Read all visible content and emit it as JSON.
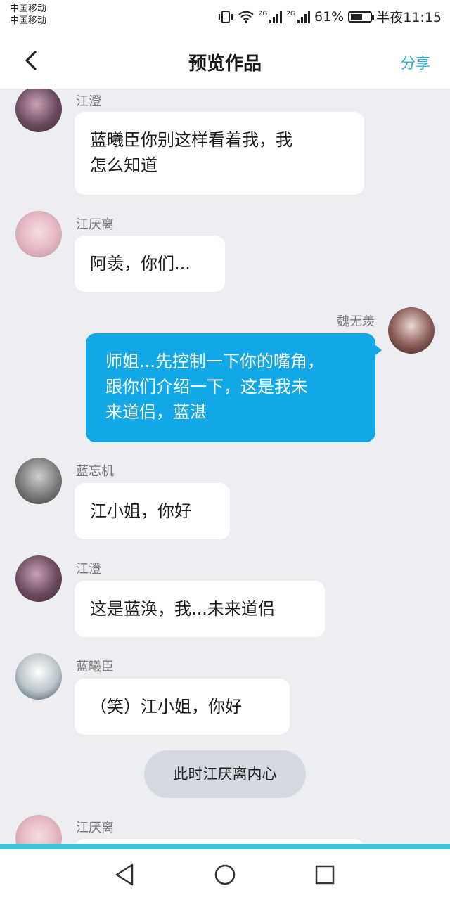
{
  "status_bar": {
    "carrier1": "中国移动",
    "carrier2": "中国移动",
    "net1": "2G",
    "net2": "2G",
    "battery_pct": "61%",
    "battery_level": 0.61,
    "time": "半夜11:15"
  },
  "header": {
    "title": "预览作品",
    "share_label": "分享"
  },
  "messages": [
    {
      "sender": "江澄",
      "text_l1": "蓝曦臣你别这样看着我，我",
      "text_l2": "怎么知道"
    },
    {
      "sender": "江厌离",
      "text": "阿羡，你们..."
    },
    {
      "sender": "魏无羡",
      "text_l1": "师姐...先控制一下你的嘴角，",
      "text_l2": "跟你们介绍一下，这是我未",
      "text_l3": "来道侣，蓝湛"
    },
    {
      "sender": "蓝忘机",
      "text": "江小姐，你好"
    },
    {
      "sender": "江澄",
      "text": "这是蓝涣，我...未来道侣"
    },
    {
      "sender": "蓝曦臣",
      "text": "（笑）江小姐，你好"
    },
    {
      "narration": "此时江厌离内心"
    },
    {
      "sender": "江厌离",
      "text": ""
    }
  ],
  "colors": {
    "accent": "#29b6d6",
    "my_bubble": "#12a8e8",
    "chat_bg": "#eceef2",
    "narration_bg": "#d6d9e1"
  },
  "icons": [
    "back-icon",
    "vibrate-icon",
    "wifi-icon",
    "signal-icon",
    "battery-icon",
    "nav-back-icon",
    "nav-home-icon",
    "nav-recent-icon"
  ]
}
